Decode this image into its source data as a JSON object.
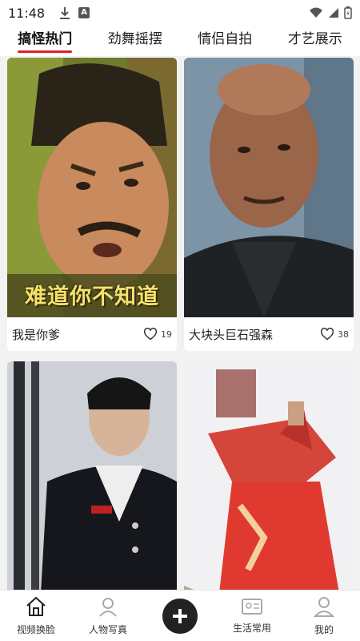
{
  "status_bar": {
    "time": "11:48",
    "input_badge": "A"
  },
  "tabs": [
    {
      "label": "搞怪热门",
      "active": true
    },
    {
      "label": "劲舞摇摆",
      "active": false
    },
    {
      "label": "情侣自拍",
      "active": false
    },
    {
      "label": "才艺展示",
      "active": false
    }
  ],
  "cards": [
    {
      "title": "我是你爹",
      "likes": "19",
      "caption": "难道你不知道"
    },
    {
      "title": "大块头巨石强森",
      "likes": "38"
    },
    {
      "title": "",
      "likes": ""
    },
    {
      "title": "",
      "likes": ""
    }
  ],
  "bottom_nav": {
    "items": [
      {
        "label": "视频换脸",
        "icon": "home-icon"
      },
      {
        "label": "人物写真",
        "icon": "portrait-icon"
      },
      {
        "label": "生活常用",
        "icon": "id-card-icon"
      },
      {
        "label": "我的",
        "icon": "user-icon"
      }
    ],
    "center_icon": "plus-icon"
  },
  "colors": {
    "accent": "#e02020",
    "fab": "#222222"
  }
}
